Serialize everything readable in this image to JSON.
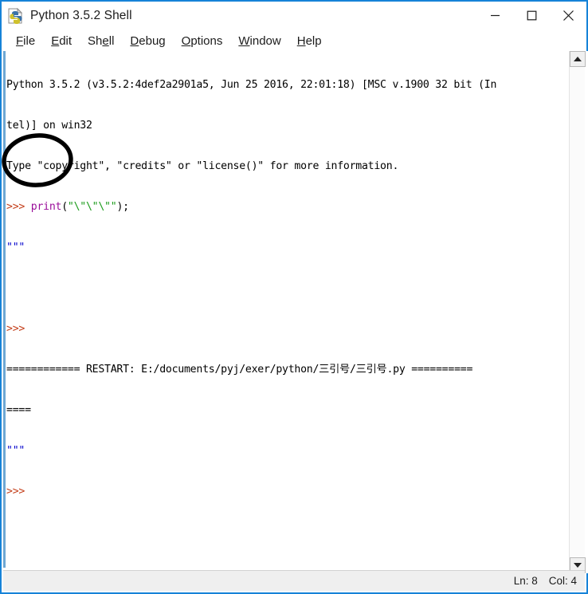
{
  "window": {
    "title": "Python 3.5.2 Shell",
    "icon": "python-idle-icon",
    "accent_color": "#1683d8"
  },
  "caption": {
    "minimize_label": "Minimize",
    "maximize_label": "Maximize",
    "close_label": "Close"
  },
  "menubar": {
    "items": [
      {
        "label": "File",
        "mnemonic_index": 0
      },
      {
        "label": "Edit",
        "mnemonic_index": 0
      },
      {
        "label": "Shell",
        "mnemonic_index": 2
      },
      {
        "label": "Debug",
        "mnemonic_index": 0
      },
      {
        "label": "Options",
        "mnemonic_index": 0
      },
      {
        "label": "Window",
        "mnemonic_index": 0
      },
      {
        "label": "Help",
        "mnemonic_index": 0
      }
    ]
  },
  "shell": {
    "banner_line_1": "Python 3.5.2 (v3.5.2:4def2a2901a5, Jun 25 2016, 22:01:18) [MSC v.1900 32 bit (In",
    "banner_line_2": "tel)] on win32",
    "banner_line_3": "Type \"copyright\", \"credits\" or \"license()\" for more information.",
    "prompt": ">>> ",
    "command_keyword": "print",
    "command_open_paren": "(",
    "command_string": "\"\\\"\\\"\\\"\"",
    "command_close": ");",
    "command_full": ">>> print(\"\\\"\\\"\\\"\");",
    "output_1": "\"\"\"",
    "empty_prompt": ">>> ",
    "restart_prefix": "============ RESTART: ",
    "restart_path": "E:/documents/pyj/exer/python/三引号/三引号.py",
    "restart_suffix": " ==========",
    "restart_line": "============ RESTART: E:/documents/pyj/exer/python/三引号/三引号.py ==========",
    "restart_wrap": "====",
    "output_2": "\"\"\"",
    "final_prompt": ">>> ",
    "colors": {
      "prompt": "#c4401c",
      "keyword": "#9a0e9a",
      "string": "#1a9b1a",
      "output": "#0000cc",
      "text": "#000000"
    }
  },
  "scrollbar": {
    "up_arrow": "scroll-up-arrow",
    "down_arrow": "scroll-down-arrow"
  },
  "statusbar": {
    "line_label": "Ln: 8",
    "col_label": "Col: 4"
  },
  "annotation": {
    "shape": "ellipse",
    "color": "#000000",
    "note": "hand-drawn circle highlighting the ==== wrap and \"\"\" output"
  },
  "watermark": {
    "text": ""
  }
}
